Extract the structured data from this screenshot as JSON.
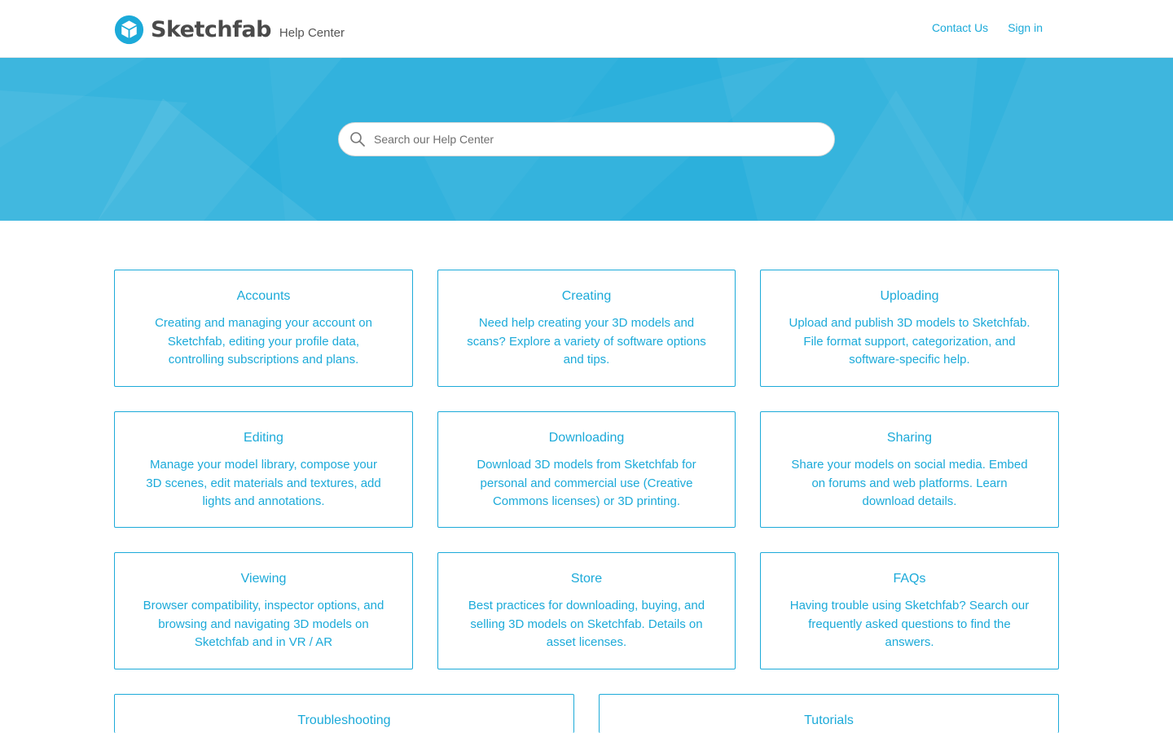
{
  "header": {
    "logo_text": "Sketchfab",
    "subtitle": "Help Center",
    "nav": [
      {
        "label": "Contact Us"
      },
      {
        "label": "Sign in"
      }
    ]
  },
  "hero": {
    "search_placeholder": "Search our Help Center"
  },
  "categories": [
    {
      "title": "Accounts",
      "description": "Creating and managing your account on Sketchfab, editing your profile data, controlling subscriptions and plans."
    },
    {
      "title": "Creating",
      "description": "Need help creating your 3D models and scans? Explore a variety of software options and tips."
    },
    {
      "title": "Uploading",
      "description": "Upload and publish 3D models to Sketchfab. File format support, categorization, and software-specific help."
    },
    {
      "title": "Editing",
      "description": "Manage your model library, compose your 3D scenes, edit materials and textures, add lights and annotations."
    },
    {
      "title": "Downloading",
      "description": "Download 3D models from Sketchfab for personal and commercial use (Creative Commons licenses) or 3D printing."
    },
    {
      "title": "Sharing",
      "description": "Share your models on social media. Embed on forums and web platforms. Learn download details."
    },
    {
      "title": "Viewing",
      "description": "Browser compatibility, inspector options, and browsing and navigating 3D models on Sketchfab and in VR / AR"
    },
    {
      "title": "Store",
      "description": "Best practices for downloading, buying, and selling 3D models on Sketchfab. Details on asset licenses."
    },
    {
      "title": "FAQs",
      "description": "Having trouble using Sketchfab? Search our frequently asked questions to find the answers."
    },
    {
      "title": "Troubleshooting",
      "description": ""
    },
    {
      "title": "Tutorials",
      "description": ""
    }
  ],
  "colors": {
    "accent": "#1caad9",
    "hero_bg": "#2cb0dc"
  }
}
